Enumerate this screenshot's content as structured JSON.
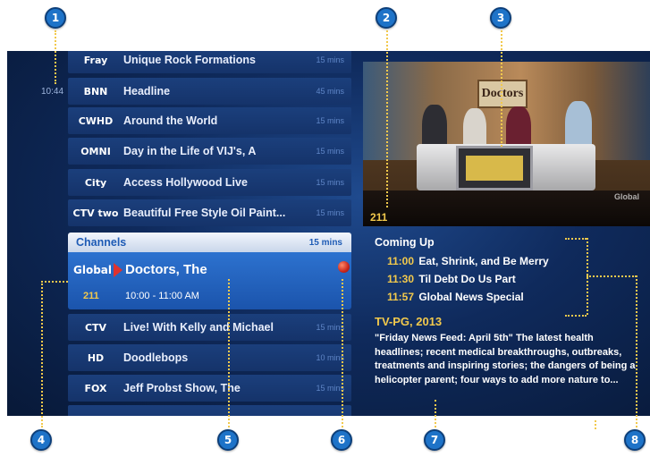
{
  "callouts": [
    "1",
    "2",
    "3",
    "4",
    "5",
    "6",
    "7",
    "8"
  ],
  "guide": {
    "current_time": "10:44",
    "rows_before": [
      {
        "logo": "Fray",
        "title": "Unique Rock Formations",
        "duration": "15 mins"
      },
      {
        "logo": "BNN",
        "title": "Headline",
        "duration": "45 mins"
      },
      {
        "logo": "CWHD",
        "title": "Around the World",
        "duration": "15 mins"
      },
      {
        "logo": "OMNI",
        "title": "Day in the Life of VIJ's, A",
        "duration": "15 mins"
      },
      {
        "logo": "City",
        "title": "Access Hollywood Live",
        "duration": "15 mins"
      },
      {
        "logo": "CTV two",
        "title": "Beautiful Free Style Oil Paint...",
        "duration": "15 mins"
      }
    ],
    "channels_label": "Channels",
    "channels_duration": "15 mins",
    "selected": {
      "logo": "Global",
      "title": "Doctors, The",
      "channel": "211",
      "time": "10:00 - 11:00 AM",
      "icon": "record-icon"
    },
    "rows_after": [
      {
        "logo": "CTV",
        "title": "Live! With Kelly and Michael",
        "duration": "15 mins"
      },
      {
        "logo": "HD",
        "title": "Doodlebops",
        "duration": "10 mins"
      },
      {
        "logo": "FOX",
        "title": "Jeff Probst Show, The",
        "duration": "15 mins"
      }
    ]
  },
  "video": {
    "channel_number": "211",
    "sign_text": "Doctors",
    "watermark": "Global"
  },
  "details": {
    "coming_up_label": "Coming Up",
    "coming_up": [
      {
        "time": "11:00",
        "title": "Eat, Shrink, and Be Merry"
      },
      {
        "time": "11:30",
        "title": "Til Debt Do Us Part"
      },
      {
        "time": "11:57",
        "title": "Global News Special"
      }
    ],
    "rating": "TV-PG, 2013",
    "description": "\"Friday News Feed: April 5th\" The latest health headlines; recent medical breakthroughs, outbreaks, treatments and inspiring stories; the dangers of being a helicopter parent; four ways to add more nature to..."
  },
  "colors": {
    "callout": "#1e73c8",
    "leader": "#f2c94c",
    "selected_row": "#2d72cf",
    "accent_yellow": "#f2c94c"
  }
}
